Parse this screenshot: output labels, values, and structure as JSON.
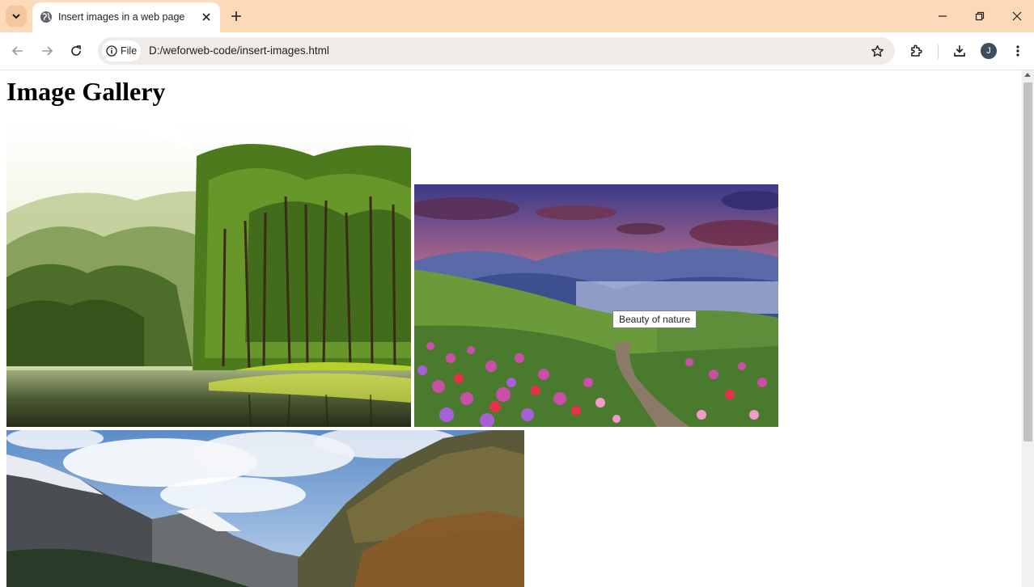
{
  "browser": {
    "tab_title": "Insert images in a web page",
    "address_chip": "File",
    "url": "D:/weforweb-code/insert-images.html",
    "profile_initial": "J",
    "accent_color": "#fcd9b8"
  },
  "page": {
    "title": "Image Gallery",
    "tooltip": "Beauty of nature",
    "images": [
      {
        "subject": "forest-lake"
      },
      {
        "subject": "flower-valley-sunset"
      },
      {
        "subject": "snowy-mountains"
      }
    ]
  }
}
